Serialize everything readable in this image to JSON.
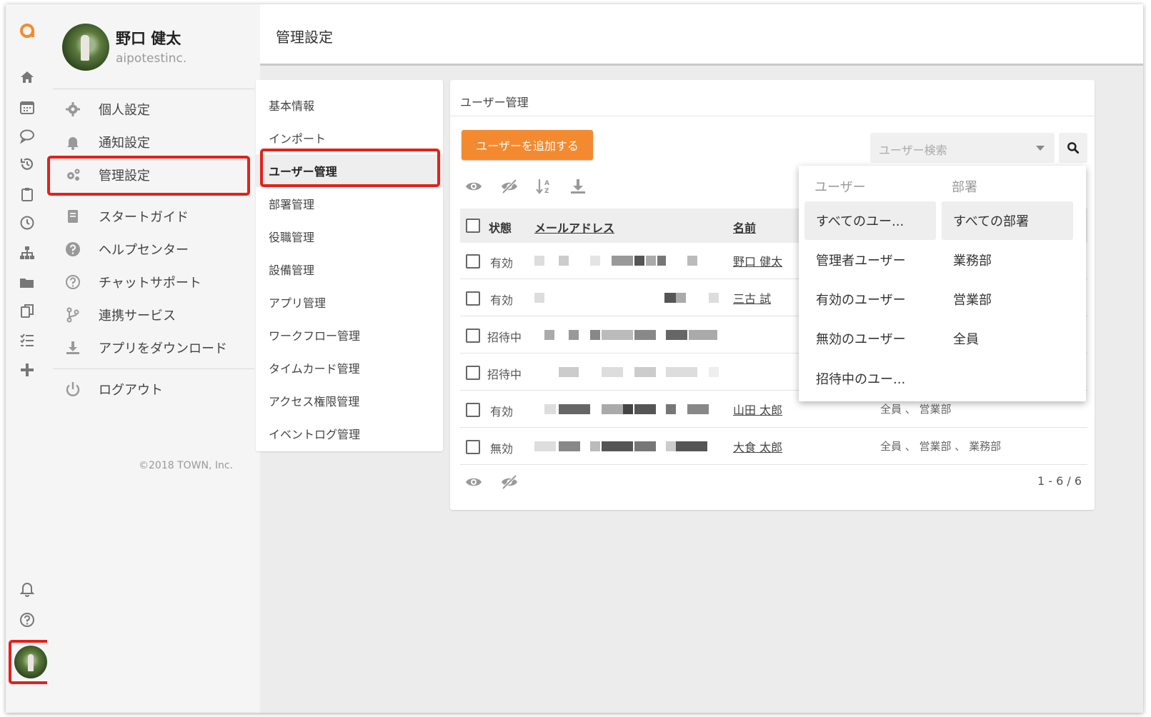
{
  "profile": {
    "name": "野口 健太",
    "org": "aipotestinc."
  },
  "menu": [
    {
      "label": "個人設定",
      "icon": "gear-icon"
    },
    {
      "label": "通知設定",
      "icon": "bell-icon"
    },
    {
      "label": "管理設定",
      "icon": "gears-icon"
    },
    {
      "label": "スタートガイド",
      "icon": "book-icon"
    },
    {
      "label": "ヘルプセンター",
      "icon": "help-circle-icon"
    },
    {
      "label": "チャットサポート",
      "icon": "question-outline-icon"
    },
    {
      "label": "連携サービス",
      "icon": "branch-icon"
    },
    {
      "label": "アプリをダウンロード",
      "icon": "download-icon"
    },
    {
      "label": "ログアウト",
      "icon": "power-icon"
    }
  ],
  "copyright": "©2018 TOWN, Inc.",
  "header": {
    "title": "管理設定"
  },
  "settings_nav": [
    "基本情報",
    "インポート",
    "ユーザー管理",
    "部署管理",
    "役職管理",
    "設備管理",
    "アプリ管理",
    "ワークフロー管理",
    "タイムカード管理",
    "アクセス権限管理",
    "イベントログ管理"
  ],
  "settings_nav_active": "ユーザー管理",
  "user_mgmt": {
    "title": "ユーザー管理",
    "add_button": "ユーザーを追加する",
    "search_placeholder": "ユーザー検索",
    "columns": {
      "status": "状態",
      "email": "メールアドレス",
      "name": "名前"
    },
    "rows": [
      {
        "status": "有効",
        "name": "野口 健太",
        "dept": ""
      },
      {
        "status": "有効",
        "name": "三古 試",
        "dept": ""
      },
      {
        "status": "招待中",
        "name": "",
        "dept": ""
      },
      {
        "status": "招待中",
        "name": "",
        "dept": ""
      },
      {
        "status": "有効",
        "name": "山田 太郎",
        "dept": "全員 、 営業部"
      },
      {
        "status": "無効",
        "name": "大食 太郎",
        "dept": "全員 、 営業部 、 業務部"
      }
    ],
    "pagination": "1 - 6 / 6"
  },
  "filter_dropdown": {
    "user_header": "ユーザー",
    "dept_header": "部署",
    "user_options": [
      "すべてのユー...",
      "管理者ユーザー",
      "有効のユーザー",
      "無効のユーザー",
      "招待中のユー..."
    ],
    "dept_options": [
      "すべての部署",
      "業務部",
      "営業部",
      "全員"
    ],
    "selected_user": "すべてのユー...",
    "selected_dept": "すべての部署"
  },
  "colors": {
    "accent": "#f48a2f",
    "highlight": "#e5201b",
    "logo": "#f48a2f"
  }
}
